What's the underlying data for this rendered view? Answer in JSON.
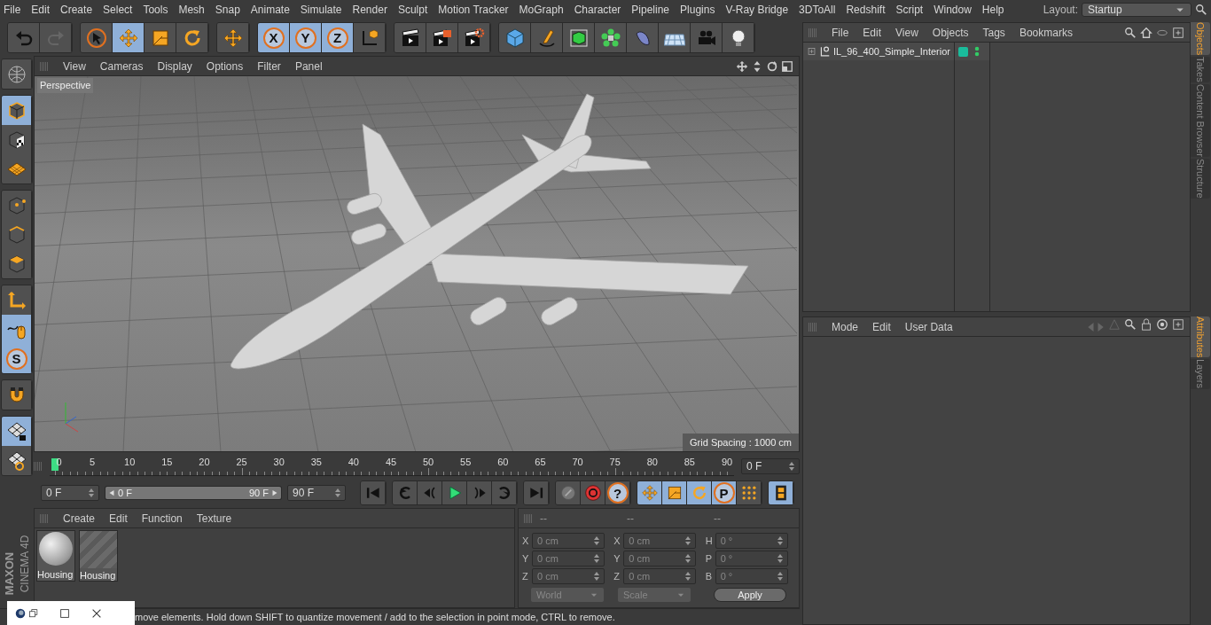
{
  "menu_bar": [
    "File",
    "Edit",
    "Create",
    "Select",
    "Tools",
    "Mesh",
    "Snap",
    "Animate",
    "Simulate",
    "Render",
    "Sculpt",
    "Motion Tracker",
    "MoGraph",
    "Character",
    "Pipeline",
    "Plugins",
    "V-Ray Bridge",
    "3DToAll",
    "Redshift",
    "Script",
    "Window",
    "Help"
  ],
  "layout": {
    "label": "Layout:",
    "value": "Startup"
  },
  "toolbar": [
    [
      {
        "kind": "undo",
        "selected": false
      },
      {
        "kind": "redo",
        "selected": false
      }
    ],
    [
      {
        "kind": "select",
        "selected": false
      },
      {
        "kind": "move",
        "selected": true
      },
      {
        "kind": "scale",
        "selected": false
      },
      {
        "kind": "rotate",
        "selected": false
      }
    ],
    [
      {
        "kind": "move",
        "selected": false
      }
    ],
    [
      {
        "kind": "letter",
        "label": "X",
        "selected": true
      },
      {
        "kind": "letter",
        "label": "Y",
        "selected": true
      },
      {
        "kind": "letter",
        "label": "Z",
        "selected": true
      },
      {
        "kind": "coord",
        "selected": false
      }
    ],
    [
      {
        "kind": "clapper",
        "selected": false
      },
      {
        "kind": "clapper_picture",
        "selected": false
      },
      {
        "kind": "clapper_settings",
        "selected": false
      }
    ],
    [
      {
        "kind": "cube",
        "selected": false
      },
      {
        "kind": "pen",
        "selected": false
      },
      {
        "kind": "subdiv",
        "selected": false
      },
      {
        "kind": "cloner",
        "selected": false
      },
      {
        "kind": "deformer",
        "selected": false
      },
      {
        "kind": "floor",
        "selected": false
      },
      {
        "kind": "camera",
        "selected": false
      },
      {
        "kind": "light",
        "selected": false
      }
    ]
  ],
  "left_toolbar": [
    [
      {
        "kind": "globe",
        "selected": false
      }
    ],
    [
      {
        "kind": "model",
        "selected": true
      },
      {
        "kind": "texture",
        "selected": false
      },
      {
        "kind": "workplane",
        "selected": false
      }
    ],
    [
      {
        "kind": "points",
        "selected": false
      },
      {
        "kind": "edges",
        "selected": false
      },
      {
        "kind": "polygons",
        "selected": false
      }
    ],
    [
      {
        "kind": "axis",
        "selected": false
      },
      {
        "kind": "mouse",
        "selected": true
      },
      {
        "kind": "letter",
        "label": "S",
        "selected": true
      }
    ],
    [
      {
        "kind": "magnet",
        "selected": false
      }
    ],
    [
      {
        "kind": "grid_lock",
        "selected": true
      },
      {
        "kind": "grid_sync",
        "selected": false
      }
    ]
  ],
  "viewport": {
    "menu": [
      "View",
      "Cameras",
      "Display",
      "Options",
      "Filter",
      "Panel"
    ],
    "camera": "Perspective",
    "grid_spacing": "Grid Spacing : 1000 cm"
  },
  "timeline": {
    "ticks": [
      "0",
      "5",
      "10",
      "15",
      "20",
      "25",
      "30",
      "35",
      "40",
      "45",
      "50",
      "55",
      "60",
      "65",
      "70",
      "75",
      "80",
      "85",
      "90"
    ],
    "level": 0,
    "frame": "0 F"
  },
  "playback": {
    "start": "0 F",
    "range": {
      "start": "0 F",
      "end": "90 F",
      "level": 1
    },
    "end": "90 F",
    "buttons": [
      [
        {
          "kind": "first",
          "selected": false
        }
      ],
      [
        {
          "kind": "prev_key",
          "selected": false
        },
        {
          "kind": "prev_frame",
          "selected": false
        },
        {
          "kind": "play",
          "selected": false
        },
        {
          "kind": "next_frame",
          "selected": false
        },
        {
          "kind": "next_key",
          "selected": false
        }
      ],
      [
        {
          "kind": "last",
          "selected": false
        }
      ],
      [
        {
          "kind": "record_off",
          "selected": false
        },
        {
          "kind": "record",
          "selected": false
        },
        {
          "kind": "letter",
          "label": "?",
          "selected": false
        }
      ],
      [
        {
          "kind": "move",
          "selected": true
        },
        {
          "kind": "scale",
          "selected": true
        },
        {
          "kind": "rotate",
          "selected": true
        },
        {
          "kind": "letter",
          "label": "P",
          "selected": true
        },
        {
          "kind": "dots",
          "selected": false
        }
      ],
      [
        {
          "kind": "film",
          "selected": true
        }
      ]
    ]
  },
  "material_manager": {
    "menu": [
      "Create",
      "Edit",
      "Function",
      "Texture"
    ],
    "materials": [
      {
        "name": "Housing",
        "kind": "sphere"
      },
      {
        "name": "Housing",
        "kind": "empty"
      }
    ]
  },
  "coordinates": {
    "headers": [
      "--",
      "--",
      "--"
    ],
    "columns": [
      [
        {
          "axis": "X",
          "value": "0 cm"
        },
        {
          "axis": "Y",
          "value": "0 cm"
        },
        {
          "axis": "Z",
          "value": "0 cm"
        }
      ],
      [
        {
          "axis": "X",
          "value": "0 cm"
        },
        {
          "axis": "Y",
          "value": "0 cm"
        },
        {
          "axis": "Z",
          "value": "0 cm"
        }
      ],
      [
        {
          "axis": "H",
          "value": "0 °"
        },
        {
          "axis": "P",
          "value": "0 °"
        },
        {
          "axis": "B",
          "value": "0 °"
        }
      ]
    ],
    "system": "World",
    "mode": "Scale",
    "apply": "Apply"
  },
  "brand": {
    "company": "MAXON",
    "product": "CINEMA 4D"
  },
  "status_bar": "move elements. Hold down SHIFT to quantize movement / add to the selection in point mode, CTRL to remove.",
  "objects": {
    "menu": [
      "File",
      "Edit",
      "View",
      "Objects",
      "Tags",
      "Bookmarks"
    ],
    "items": [
      {
        "name": "IL_96_400_Simple_Interior",
        "color": "#1abc9c"
      }
    ]
  },
  "attributes": {
    "menu": [
      "Mode",
      "Edit",
      "User Data"
    ]
  },
  "side_tabs_upper": [
    {
      "label": "Objects",
      "selected": true
    },
    {
      "label": "Takes",
      "selected": false
    },
    {
      "label": "Content Browser",
      "selected": false
    },
    {
      "label": "Structure",
      "selected": false
    }
  ],
  "side_tabs_lower": [
    {
      "label": "Attributes",
      "selected": true
    },
    {
      "label": "Layers",
      "selected": false
    }
  ]
}
